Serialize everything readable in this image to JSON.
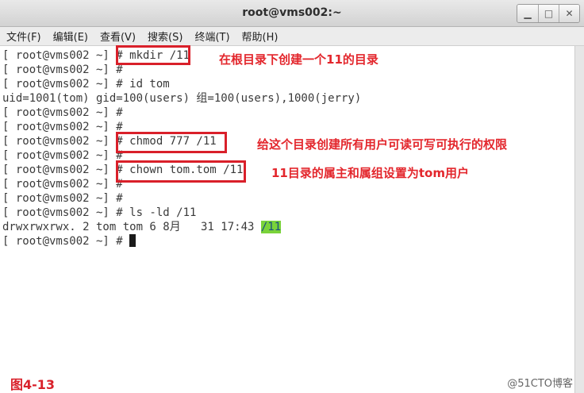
{
  "window": {
    "title": "root@vms002:~",
    "buttons": [
      "▁",
      "□",
      "✕"
    ]
  },
  "menu": [
    "文件(F)",
    "编辑(E)",
    "查看(V)",
    "搜索(S)",
    "终端(T)",
    "帮助(H)"
  ],
  "terminal": {
    "prompt": "[ root@vms002 ~] # ",
    "lines": [
      {
        "type": "cmd",
        "cmd": "mkdir /11"
      },
      {
        "type": "cmd",
        "cmd": ""
      },
      {
        "type": "cmd",
        "cmd": "id tom"
      },
      {
        "type": "out",
        "text": "uid=1001(tom) gid=100(users) 组=100(users),1000(jerry)"
      },
      {
        "type": "cmd",
        "cmd": ""
      },
      {
        "type": "cmd",
        "cmd": ""
      },
      {
        "type": "cmd",
        "cmd": "chmod 777 /11"
      },
      {
        "type": "cmd",
        "cmd": ""
      },
      {
        "type": "cmd",
        "cmd": "chown tom.tom /11"
      },
      {
        "type": "cmd",
        "cmd": ""
      },
      {
        "type": "cmd",
        "cmd": ""
      },
      {
        "type": "cmd",
        "cmd": "ls -ld /11"
      },
      {
        "type": "out",
        "text": "drwxrwxrwx. 2 tom tom 6 8月   31 17:43 ",
        "hl": "/11"
      },
      {
        "type": "cmd",
        "cmd": "",
        "cursor": true
      }
    ]
  },
  "annotations": {
    "note_mkdir": "在根目录下创建一个11的目录",
    "note_chmod": "给这个目录创建所有用户可读可写可执行的权限",
    "note_chown": "11目录的属主和属组设置为tom用户"
  },
  "figure_label": "图4-13",
  "watermark": "@51CTO博客",
  "colors": {
    "annotation": "#d9202a",
    "dir_highlight": "#7ad33a",
    "dir_text": "#1a4f80"
  }
}
